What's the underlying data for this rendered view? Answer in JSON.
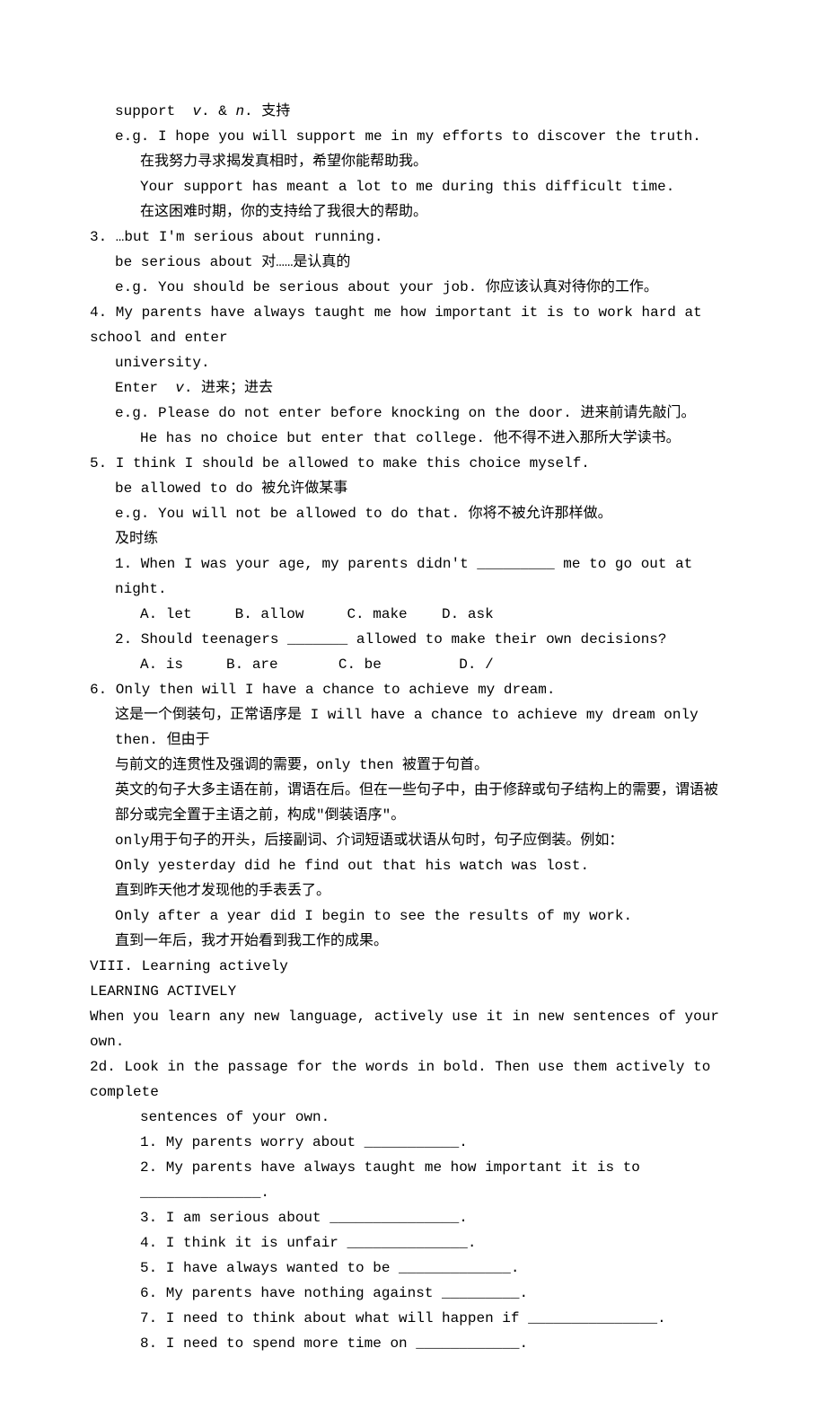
{
  "lines": [
    {
      "indent": 1,
      "parts": [
        {
          "t": "support  "
        },
        {
          "t": "v",
          "italic": true
        },
        {
          "t": ". & "
        },
        {
          "t": "n",
          "italic": true
        },
        {
          "t": ". 支持"
        }
      ]
    },
    {
      "indent": 1,
      "text": "e.g. I hope you will support me in my efforts to discover the truth."
    },
    {
      "indent": 2,
      "text": "在我努力寻求揭发真相时，希望你能帮助我。"
    },
    {
      "indent": 2,
      "text": "Your support has meant a lot to me during this difficult time."
    },
    {
      "indent": 2,
      "text": "在这困难时期，你的支持给了我很大的帮助。"
    },
    {
      "indent": 0,
      "text": "3. …but I'm serious about running."
    },
    {
      "indent": 1,
      "text": "be serious about 对……是认真的"
    },
    {
      "indent": 1,
      "text": "e.g. You should be serious about your job. 你应该认真对待你的工作。"
    },
    {
      "indent": 0,
      "text": "4. My parents have always taught me how important it is to work hard at school and enter"
    },
    {
      "indent": 1,
      "text": "university."
    },
    {
      "indent": 1,
      "parts": [
        {
          "t": "Enter  "
        },
        {
          "t": "v",
          "italic": true
        },
        {
          "t": ". 进来；进去"
        }
      ]
    },
    {
      "indent": 1,
      "text": "e.g. Please do not enter before knocking on the door. 进来前请先敲门。"
    },
    {
      "indent": 2,
      "text": "He has no choice but enter that college. 他不得不进入那所大学读书。"
    },
    {
      "indent": 0,
      "text": "5. I think I should be allowed to make this choice myself."
    },
    {
      "indent": 1,
      "text": "be allowed to do 被允许做某事"
    },
    {
      "indent": 1,
      "text": "e.g. You will not be allowed to do that. 你将不被允许那样做。"
    },
    {
      "indent": 1,
      "text": "及时练"
    },
    {
      "indent": 1,
      "text": "1. When I was your age, my parents didn't _________ me to go out at night."
    },
    {
      "indent": 2,
      "text": "A. let     B. allow     C. make    D. ask"
    },
    {
      "indent": 1,
      "text": "2. Should teenagers _______ allowed to make their own decisions?"
    },
    {
      "indent": 2,
      "text": "A. is     B. are       C. be         D. /"
    },
    {
      "indent": 0,
      "text": "6. Only then will I have a chance to achieve my dream."
    },
    {
      "indent": 1,
      "text": "这是一个倒装句，正常语序是 I will have a chance to achieve my dream only then. 但由于"
    },
    {
      "indent": 1,
      "text": "与前文的连贯性及强调的需要，only then 被置于句首。"
    },
    {
      "indent": 1,
      "text": "英文的句子大多主语在前，谓语在后。但在一些句子中，由于修辞或句子结构上的需要，谓语被"
    },
    {
      "indent": 1,
      "text": "部分或完全置于主语之前，构成\"倒装语序\"。"
    },
    {
      "indent": 1,
      "text": "only用于句子的开头，后接副词、介词短语或状语从句时，句子应倒装。例如："
    },
    {
      "indent": 1,
      "text": "Only yesterday did he find out that his watch was lost."
    },
    {
      "indent": 1,
      "text": "直到昨天他才发现他的手表丢了。"
    },
    {
      "indent": 1,
      "text": "Only after a year did I begin to see the results of my work."
    },
    {
      "indent": 1,
      "text": "直到一年后，我才开始看到我工作的成果。"
    },
    {
      "indent": 0,
      "text": "VIII. Learning actively"
    },
    {
      "indent": 0,
      "text": "LEARNING ACTIVELY"
    },
    {
      "indent": 0,
      "text": "When you learn any new language, actively use it in new sentences of your own."
    },
    {
      "indent": 0,
      "text": "2d. Look in the passage for the words in bold. Then use them actively to complete"
    },
    {
      "indent": 2,
      "text": "sentences of your own."
    },
    {
      "indent": 2,
      "text": "1. My parents worry about ___________."
    },
    {
      "indent": 2,
      "text": "2. My parents have always taught me how important it is to ______________."
    },
    {
      "indent": 2,
      "text": "3. I am serious about _______________."
    },
    {
      "indent": 2,
      "text": "4. I think it is unfair ______________."
    },
    {
      "indent": 2,
      "text": "5. I have always wanted to be _____________."
    },
    {
      "indent": 2,
      "text": "6. My parents have nothing against _________."
    },
    {
      "indent": 2,
      "text": "7. I need to think about what will happen if _______________."
    },
    {
      "indent": 2,
      "text": "8. I need to spend more time on ____________."
    }
  ]
}
